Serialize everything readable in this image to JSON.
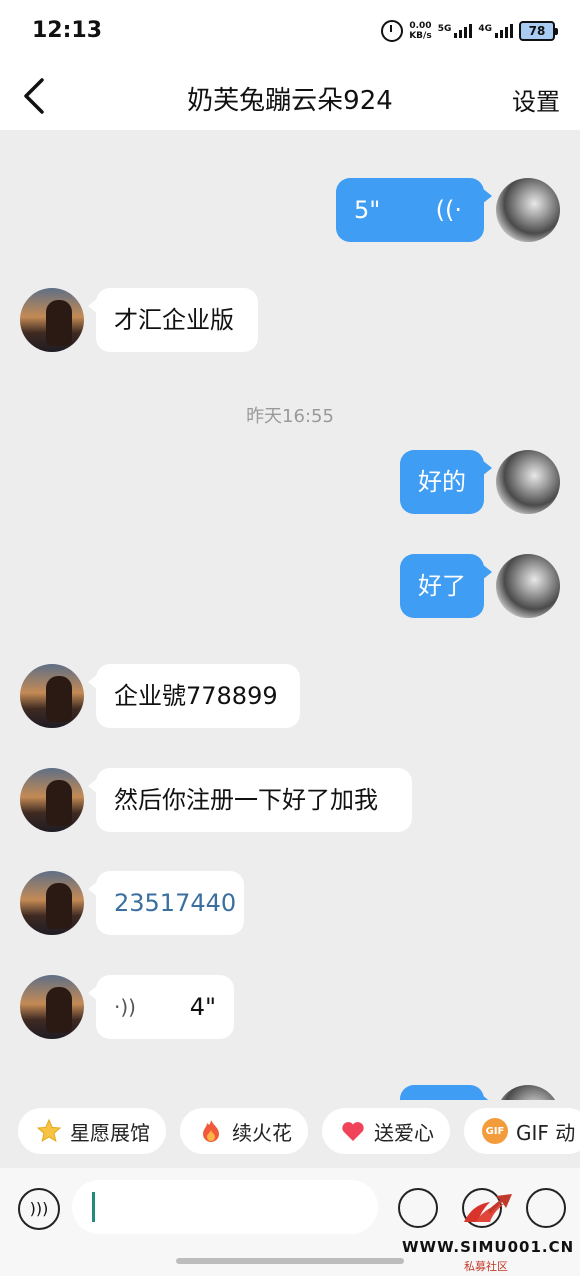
{
  "status_bar": {
    "time": "12:13",
    "net_speed_value": "0.00",
    "net_speed_unit": "KB/s",
    "net1": "5G",
    "net2": "4G",
    "battery": "78"
  },
  "header": {
    "title": "奶芙兔蹦云朵924",
    "settings": "设置"
  },
  "messages": [
    {
      "dir": "out",
      "text": "5\"",
      "type": "voice"
    },
    {
      "dir": "in",
      "text": "才汇企业版"
    },
    {
      "dir": "out",
      "text": "好的"
    },
    {
      "dir": "out",
      "text": "好了"
    },
    {
      "dir": "in",
      "text": "企业號778899"
    },
    {
      "dir": "in",
      "text": "然后你注册一下好了加我"
    },
    {
      "dir": "in",
      "text": "23517440",
      "type": "link"
    },
    {
      "dir": "in",
      "text": "4\"",
      "type": "voice"
    }
  ],
  "timestamp": "昨天16:55",
  "quick_actions": [
    {
      "label": "星愿展馆",
      "icon": "star-icon"
    },
    {
      "label": "续火花",
      "icon": "fire-icon"
    },
    {
      "label": "送爱心",
      "icon": "heart-icon"
    },
    {
      "label": "GIF 动",
      "icon": "gif-icon",
      "icon_text": "GIF"
    }
  ],
  "watermark": {
    "url": "WWW.SIMU001.CN",
    "sub": "私募社区"
  },
  "colors": {
    "outgoing_bubble": "#3f9df4",
    "background": "#ededed"
  }
}
